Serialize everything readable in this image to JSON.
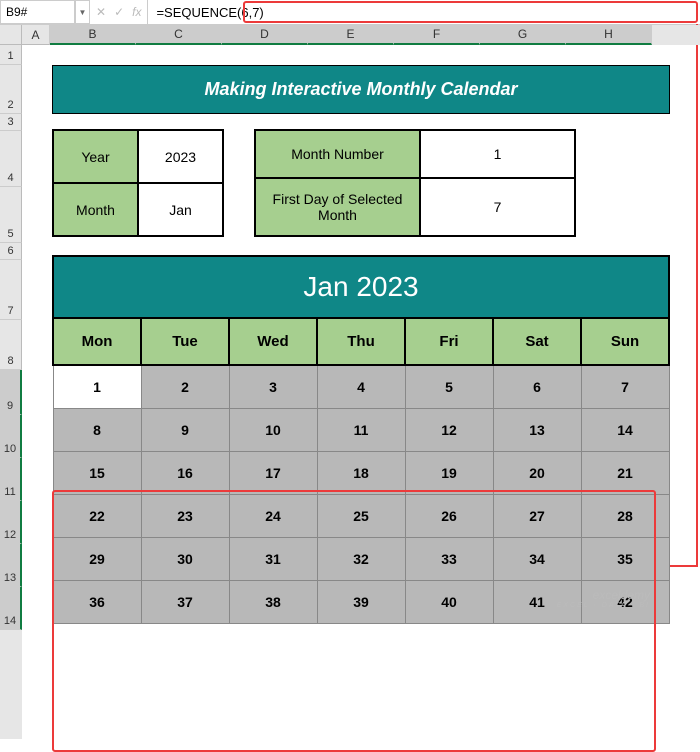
{
  "formula_bar": {
    "name_box": "B9#",
    "formula": "=SEQUENCE(6,7)"
  },
  "columns": [
    "A",
    "B",
    "C",
    "D",
    "E",
    "F",
    "G",
    "H"
  ],
  "rows": [
    "1",
    "2",
    "3",
    "4",
    "5",
    "6",
    "7",
    "8",
    "9",
    "10",
    "11",
    "12",
    "13",
    "14"
  ],
  "title": "Making Interactive Monthly Calendar",
  "info1": {
    "year_label": "Year",
    "year_value": "2023",
    "month_label": "Month",
    "month_value": "Jan"
  },
  "info2": {
    "mn_label": "Month Number",
    "mn_value": "1",
    "fd_label": "First Day of Selected Month",
    "fd_value": "7"
  },
  "calendar": {
    "title": "Jan 2023",
    "days": [
      "Mon",
      "Tue",
      "Wed",
      "Thu",
      "Fri",
      "Sat",
      "Sun"
    ],
    "grid": [
      [
        "1",
        "2",
        "3",
        "4",
        "5",
        "6",
        "7"
      ],
      [
        "8",
        "9",
        "10",
        "11",
        "12",
        "13",
        "14"
      ],
      [
        "15",
        "16",
        "17",
        "18",
        "19",
        "20",
        "21"
      ],
      [
        "22",
        "23",
        "24",
        "25",
        "26",
        "27",
        "28"
      ],
      [
        "29",
        "30",
        "31",
        "32",
        "33",
        "34",
        "35"
      ],
      [
        "36",
        "37",
        "38",
        "39",
        "40",
        "41",
        "42"
      ]
    ]
  },
  "watermark": {
    "main": "exceldemy",
    "sub": "EXCEL · DATA · BI"
  }
}
